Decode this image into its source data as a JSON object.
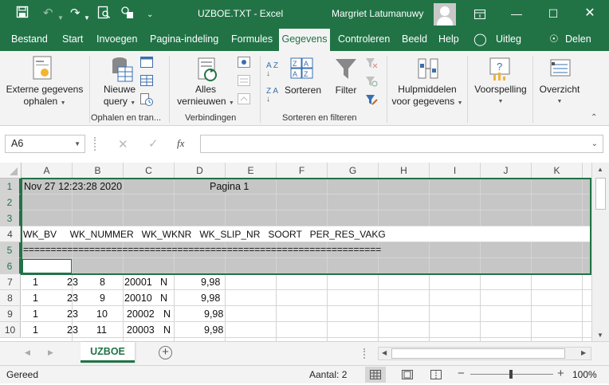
{
  "title_bar": {
    "doc_title": "UZBOE.TXT  -  Excel",
    "user_name": "Margriet Latumanuwy",
    "accent": "#217346"
  },
  "ribbon_tabs": [
    "Bestand",
    "Start",
    "Invoegen",
    "Pagina-indeling",
    "Formules",
    "Gegevens",
    "Controleren",
    "Beeld",
    "Help",
    "Uitleg",
    "Delen"
  ],
  "active_tab": "Gegevens",
  "ribbon": {
    "externe_line1": "Externe gegevens",
    "externe_line2": "ophalen",
    "nieuwe_line1": "Nieuwe",
    "nieuwe_line2": "query",
    "alles_line1": "Alles",
    "alles_line2": "vernieuwen",
    "sorteren": "Sorteren",
    "filter": "Filter",
    "hulp_line1": "Hulpmiddelen",
    "hulp_line2": "voor gegevens",
    "voorspelling": "Voorspelling",
    "overzicht": "Overzicht",
    "az": "A Z",
    "za": "Z A",
    "groups": {
      "ophalen": "Ophalen en tran...",
      "verbindingen": "Verbindingen",
      "sorteren_filteren": "Sorteren en filteren"
    }
  },
  "formula_bar": {
    "name_box": "A6",
    "fx": "fx",
    "formula": ""
  },
  "columns": [
    "A",
    "B",
    "C",
    "D",
    "E",
    "F",
    "G",
    "H",
    "I",
    "J",
    "K"
  ],
  "rows": [
    {
      "num": "1",
      "cells": [
        {
          "text": "Nov 27 12:23:28 2020"
        },
        {
          "text": "Pagina 1"
        }
      ]
    },
    {
      "num": "2",
      "cells": []
    },
    {
      "num": "3",
      "cells": []
    },
    {
      "num": "4",
      "cells": [
        {
          "text": "WK_BV     WK_NUMMER   WK_WKNR   WK_SLIP_NR   SOORT   PER_RES_VAKG"
        }
      ]
    },
    {
      "num": "5",
      "cells": [
        {
          "text": "================================================================="
        }
      ]
    },
    {
      "num": "6",
      "cells": []
    },
    {
      "num": "7",
      "cells": [
        {
          "text": "1"
        },
        {
          "text": "23"
        },
        {
          "text": "8"
        },
        {
          "text": "20001"
        },
        {
          "text": "N"
        },
        {
          "text": "9,98"
        }
      ]
    },
    {
      "num": "8",
      "cells": [
        {
          "text": "1"
        },
        {
          "text": "23"
        },
        {
          "text": "9"
        },
        {
          "text": "20010"
        },
        {
          "text": "N"
        },
        {
          "text": "9,98"
        }
      ]
    },
    {
      "num": "9",
      "cells": [
        {
          "text": "1"
        },
        {
          "text": "23"
        },
        {
          "text": "10"
        },
        {
          "text": "20002"
        },
        {
          "text": "N"
        },
        {
          "text": "9,98"
        }
      ]
    },
    {
      "num": "10",
      "cells": [
        {
          "text": "1"
        },
        {
          "text": "23"
        },
        {
          "text": "11"
        },
        {
          "text": "20003"
        },
        {
          "text": "N"
        },
        {
          "text": "9,98"
        }
      ]
    }
  ],
  "sheet_tab": "UZBOE",
  "status": {
    "ready": "Gereed",
    "count": "Aantal: 2",
    "zoom": "100%"
  }
}
